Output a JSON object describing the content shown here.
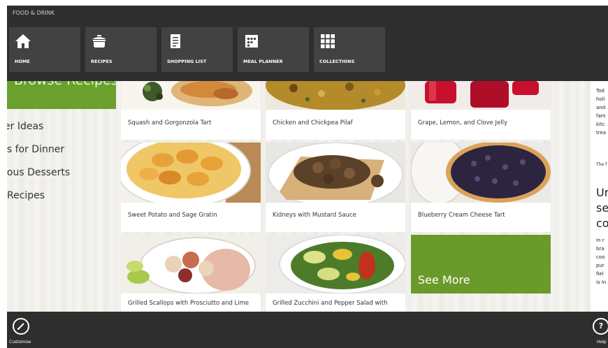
{
  "app": {
    "title": "FOOD & DRINK"
  },
  "nav": [
    {
      "label": "HOME",
      "icon": "home-icon"
    },
    {
      "label": "RECIPES",
      "icon": "pot-icon"
    },
    {
      "label": "SHOPPING LIST",
      "icon": "list-icon"
    },
    {
      "label": "MEAL PLANNER",
      "icon": "calendar-icon"
    },
    {
      "label": "COLLECTIONS",
      "icon": "grid-icon"
    }
  ],
  "left": {
    "browse": "Browse Recipes",
    "items": [
      "er Ideas",
      "'s for Dinner",
      "ious Desserts",
      "Recipes"
    ]
  },
  "cards": [
    {
      "caption": "Squash and Gorgonzola Tart"
    },
    {
      "caption": "Chicken and Chickpea Pilaf"
    },
    {
      "caption": "Grape, Lemon, and Clove Jelly"
    },
    {
      "caption": "Sweet Potato and Sage Gratin"
    },
    {
      "caption": "Kidneys with Mustard Sauce"
    },
    {
      "caption": "Blueberry Cream Cheese Tart"
    },
    {
      "caption": "Grilled Scallops with Prosciutto and Lime"
    },
    {
      "caption": "Grilled Zucchini and Pepper Salad with"
    }
  ],
  "see_more": "See More",
  "right": {
    "text_a": [
      "Tod",
      "holi",
      "and",
      "fam",
      "kitc",
      "trea"
    ],
    "text_b": "The f",
    "heading": [
      "Ur",
      "se",
      "co"
    ],
    "text_c": [
      "In r",
      "bra",
      "coo",
      "pur",
      "fiel",
      "is In"
    ]
  },
  "bottom": {
    "customise": "Customise",
    "help": "Help"
  },
  "colors": {
    "accent": "#6aa12d",
    "bar": "#2e2e2e",
    "tile": "#424242"
  }
}
